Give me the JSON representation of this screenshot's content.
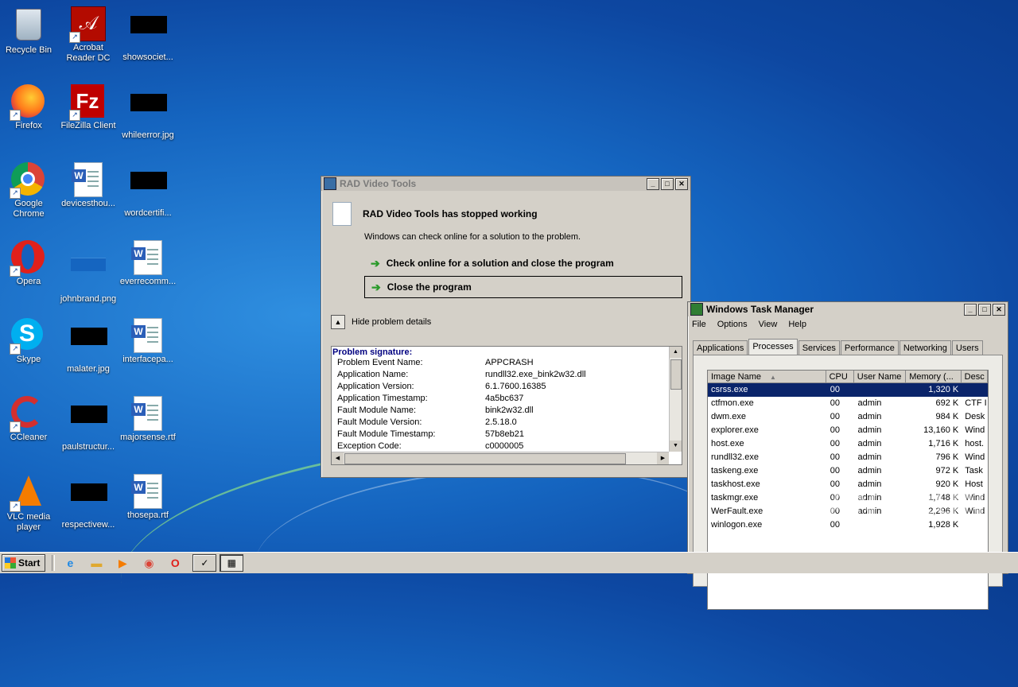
{
  "desktop": {
    "icons": [
      {
        "label": "Recycle Bin"
      },
      {
        "label": "Acrobat Reader DC"
      },
      {
        "label": "showsociet..."
      },
      {
        "label": "Firefox"
      },
      {
        "label": "FileZilla Client"
      },
      {
        "label": "whileerror.jpg"
      },
      {
        "label": "Google Chrome"
      },
      {
        "label": "devicesthou..."
      },
      {
        "label": "wordcertifi..."
      },
      {
        "label": "Opera"
      },
      {
        "label": "johnbrand.png"
      },
      {
        "label": "everrecomm..."
      },
      {
        "label": "Skype"
      },
      {
        "label": "malater.jpg"
      },
      {
        "label": "interfacepa..."
      },
      {
        "label": "CCleaner"
      },
      {
        "label": "paulstructur..."
      },
      {
        "label": "majorsense.rtf"
      },
      {
        "label": "VLC media player"
      },
      {
        "label": "respectivew..."
      },
      {
        "label": "thosepa.rtf"
      }
    ]
  },
  "crash_dialog": {
    "title": "RAD Video Tools",
    "heading": "RAD Video Tools has stopped working",
    "subtext": "Windows can check online for a solution to the problem.",
    "option_check_online": "Check online for a solution and close the program",
    "option_close": "Close the program",
    "hide_details": "Hide problem details",
    "signature_title": "Problem signature:",
    "signature": [
      {
        "k": "Problem Event Name:",
        "v": "APPCRASH"
      },
      {
        "k": "Application Name:",
        "v": "rundll32.exe_bink2w32.dll"
      },
      {
        "k": "Application Version:",
        "v": "6.1.7600.16385"
      },
      {
        "k": "Application Timestamp:",
        "v": "4a5bc637"
      },
      {
        "k": "Fault Module Name:",
        "v": "bink2w32.dll"
      },
      {
        "k": "Fault Module Version:",
        "v": "2.5.18.0"
      },
      {
        "k": "Fault Module Timestamp:",
        "v": "57b8eb21"
      },
      {
        "k": "Exception Code:",
        "v": "c0000005"
      }
    ]
  },
  "task_manager": {
    "title": "Windows Task Manager",
    "menu": [
      "File",
      "Options",
      "View",
      "Help"
    ],
    "tabs": [
      "Applications",
      "Processes",
      "Services",
      "Performance",
      "Networking",
      "Users"
    ],
    "columns": [
      "Image Name",
      "CPU",
      "User Name",
      "Memory (...",
      "Desc"
    ],
    "sort_indicator": "▲",
    "rows": [
      {
        "name": "csrss.exe",
        "cpu": "00",
        "user": "",
        "mem": "1,320 K",
        "desc": ""
      },
      {
        "name": "ctfmon.exe",
        "cpu": "00",
        "user": "admin",
        "mem": "692 K",
        "desc": "CTF I"
      },
      {
        "name": "dwm.exe",
        "cpu": "00",
        "user": "admin",
        "mem": "984 K",
        "desc": "Desk"
      },
      {
        "name": "explorer.exe",
        "cpu": "00",
        "user": "admin",
        "mem": "13,160 K",
        "desc": "Wind"
      },
      {
        "name": "host.exe",
        "cpu": "00",
        "user": "admin",
        "mem": "1,716 K",
        "desc": "host."
      },
      {
        "name": "rundll32.exe",
        "cpu": "00",
        "user": "admin",
        "mem": "796 K",
        "desc": "Wind"
      },
      {
        "name": "taskeng.exe",
        "cpu": "00",
        "user": "admin",
        "mem": "972 K",
        "desc": "Task"
      },
      {
        "name": "taskhost.exe",
        "cpu": "00",
        "user": "admin",
        "mem": "920 K",
        "desc": "Host"
      },
      {
        "name": "taskmgr.exe",
        "cpu": "00",
        "user": "admin",
        "mem": "1,748 K",
        "desc": "Wind"
      },
      {
        "name": "WerFault.exe",
        "cpu": "00",
        "user": "admin",
        "mem": "2,296 K",
        "desc": "Wind"
      },
      {
        "name": "winlogon.exe",
        "cpu": "00",
        "user": "",
        "mem": "1,928 K",
        "desc": ""
      }
    ]
  },
  "watermark": "ANY.RUN",
  "taskbar": {
    "start_label": "Start"
  }
}
